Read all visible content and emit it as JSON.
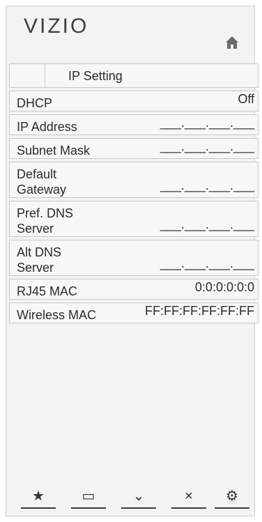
{
  "brand": {
    "logo": "VIZIO"
  },
  "header": {
    "home_icon": "home-icon"
  },
  "menu": {
    "title": "IP Setting",
    "rows": [
      {
        "label": "DHCP",
        "value": "Off"
      },
      {
        "label": "IP Address",
        "value": "___.___.___.___"
      },
      {
        "label": "Subnet Mask",
        "value": "___.___.___.___"
      },
      {
        "label": "Default\nGateway",
        "value": "___.___.___.___"
      },
      {
        "label": "Pref. DNS\nServer",
        "value": "___.___.___.___"
      },
      {
        "label": "Alt DNS\nServer",
        "value": "___.___.___.___"
      },
      {
        "label": "RJ45 MAC",
        "value": "0:0:0:0:0:0"
      },
      {
        "label": "Wireless MAC",
        "value": "FF:FF:FF:FF:FF:FF"
      }
    ]
  },
  "tabs": [
    {
      "icon": "star-icon",
      "glyph": "★"
    },
    {
      "icon": "input-icon",
      "glyph": "▭"
    },
    {
      "icon": "chevron-down-icon",
      "glyph": "⌄"
    },
    {
      "icon": "close-icon",
      "glyph": "×"
    },
    {
      "icon": "gear-icon",
      "glyph": "⚙"
    }
  ]
}
